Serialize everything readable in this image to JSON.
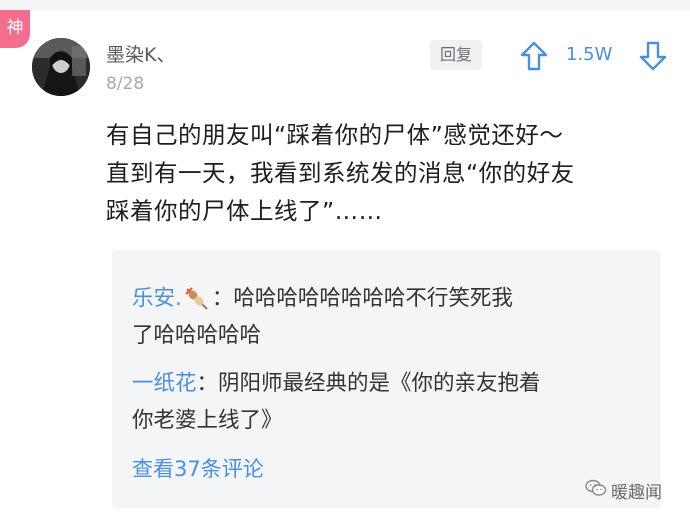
{
  "badge": "神",
  "comment": {
    "username": "墨染K、",
    "date": "8/28",
    "reply_label": "回复",
    "votes": "1.5W",
    "text_lines": [
      "有自己的朋友叫“踩着你的尸体”感觉还好～",
      "直到有一天，我看到系统发的消息“你的好友",
      "踩着你的尸体上线了”……"
    ]
  },
  "replies": [
    {
      "name": "乐安.",
      "separator": "：",
      "lines": [
        "哈哈哈哈哈哈哈哈不行笑死我",
        "了哈哈哈哈哈"
      ]
    },
    {
      "name": "一纸花",
      "separator": "：",
      "lines": [
        "阴阳师最经典的是《你的亲友抱着",
        "你老婆上线了》"
      ]
    }
  ],
  "view_more": "查看37条评论",
  "watermark": "暖趣闻",
  "colors": {
    "accent_blue": "#4a90e2",
    "badge_pink": "#f36d8f",
    "reply_bg": "#f4f5f7"
  },
  "icons": [
    "upvote-arrow-icon",
    "downvote-arrow-icon",
    "skewer-emoji-icon",
    "wechat-logo-icon"
  ]
}
